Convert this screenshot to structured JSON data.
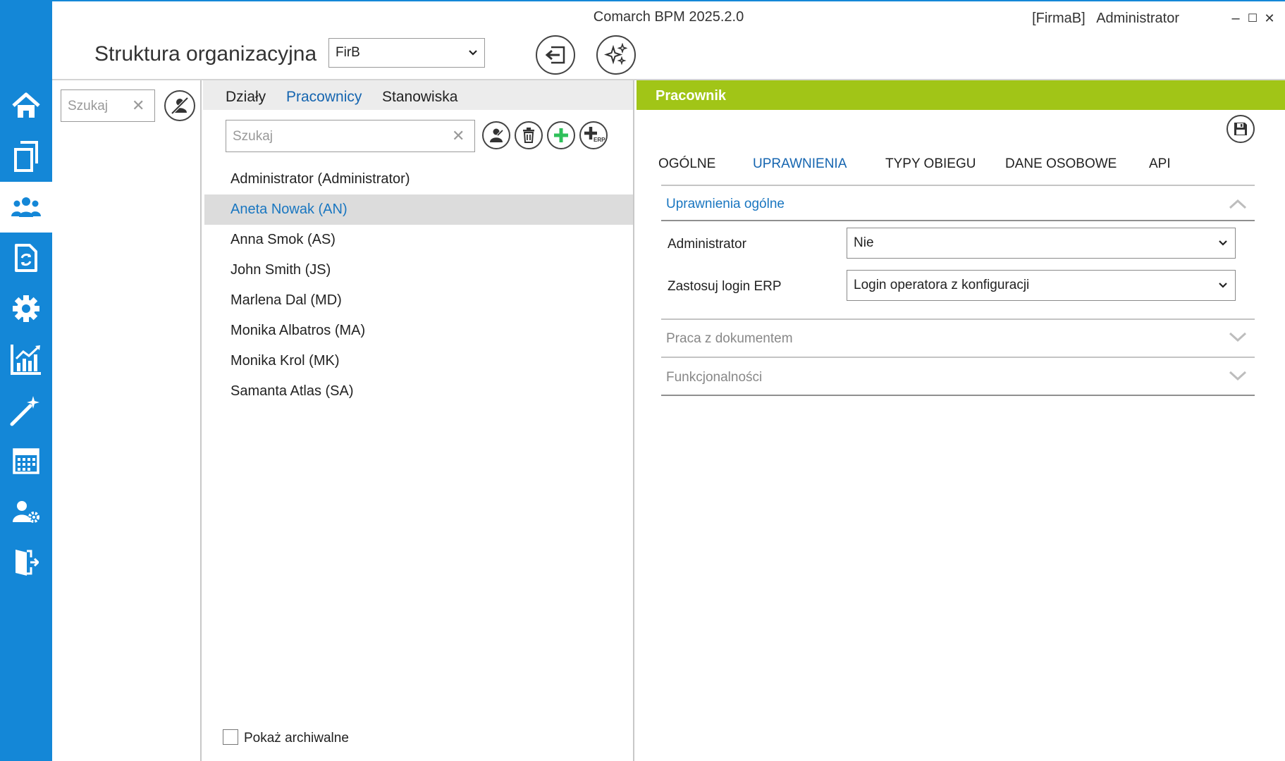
{
  "window": {
    "app_title": "Comarch BPM 2025.2.0",
    "company_tag": "[FirmaB]",
    "user": "Administrator",
    "controls": {
      "minimize": "–",
      "maximize": "☐",
      "close": "✕"
    }
  },
  "colors": {
    "sidebar": "#1487d7",
    "accent_green": "#a1c517",
    "link_blue": "#1565b0",
    "add_green": "#2fc05a"
  },
  "sidebar": {
    "items": [
      {
        "icon": "home-icon"
      },
      {
        "icon": "documents-icon"
      },
      {
        "icon": "users-icon",
        "active": true
      },
      {
        "icon": "document-sync-icon"
      },
      {
        "icon": "gear-icon"
      },
      {
        "icon": "chart-icon"
      },
      {
        "icon": "magic-wand-icon"
      },
      {
        "icon": "calendar-icon"
      },
      {
        "icon": "user-settings-icon"
      },
      {
        "icon": "exit-icon"
      }
    ]
  },
  "header": {
    "page_title": "Struktura organizacyjna",
    "company_select": "FirB"
  },
  "left_panel": {
    "search_placeholder": "Szukaj"
  },
  "middle_panel": {
    "tabs": [
      "Działy",
      "Pracownicy",
      "Stanowiska"
    ],
    "active_tab": "Pracownicy",
    "search_placeholder": "Szukaj",
    "employees": [
      "Administrator (Administrator)",
      "Aneta Nowak (AN)",
      "Anna Smok (AS)",
      "John Smith (JS)",
      "Marlena Dal (MD)",
      "Monika Albatros (MA)",
      "Monika Krol (MK)",
      "Samanta Atlas (SA)"
    ],
    "selected_employee": "Aneta Nowak (AN)",
    "show_archived_label": "Pokaż archiwalne",
    "show_archived_checked": false,
    "erp_badge": "ERP"
  },
  "right_panel": {
    "title": "Pracownik",
    "tabs": [
      "OGÓLNE",
      "UPRAWNIENIA",
      "TYPY OBIEGU",
      "DANE OSOBOWE",
      "API"
    ],
    "active_tab": "UPRAWNIENIA",
    "sections": {
      "general": {
        "title": "Uprawnienia ogólne",
        "expanded": true,
        "fields": [
          {
            "label": "Administrator",
            "value": "Nie"
          },
          {
            "label": "Zastosuj login ERP",
            "value": "Login operatora z konfiguracji"
          }
        ]
      },
      "documents": {
        "title": "Praca z dokumentem",
        "expanded": false
      },
      "functions": {
        "title": "Funkcjonalności",
        "expanded": false
      }
    }
  }
}
